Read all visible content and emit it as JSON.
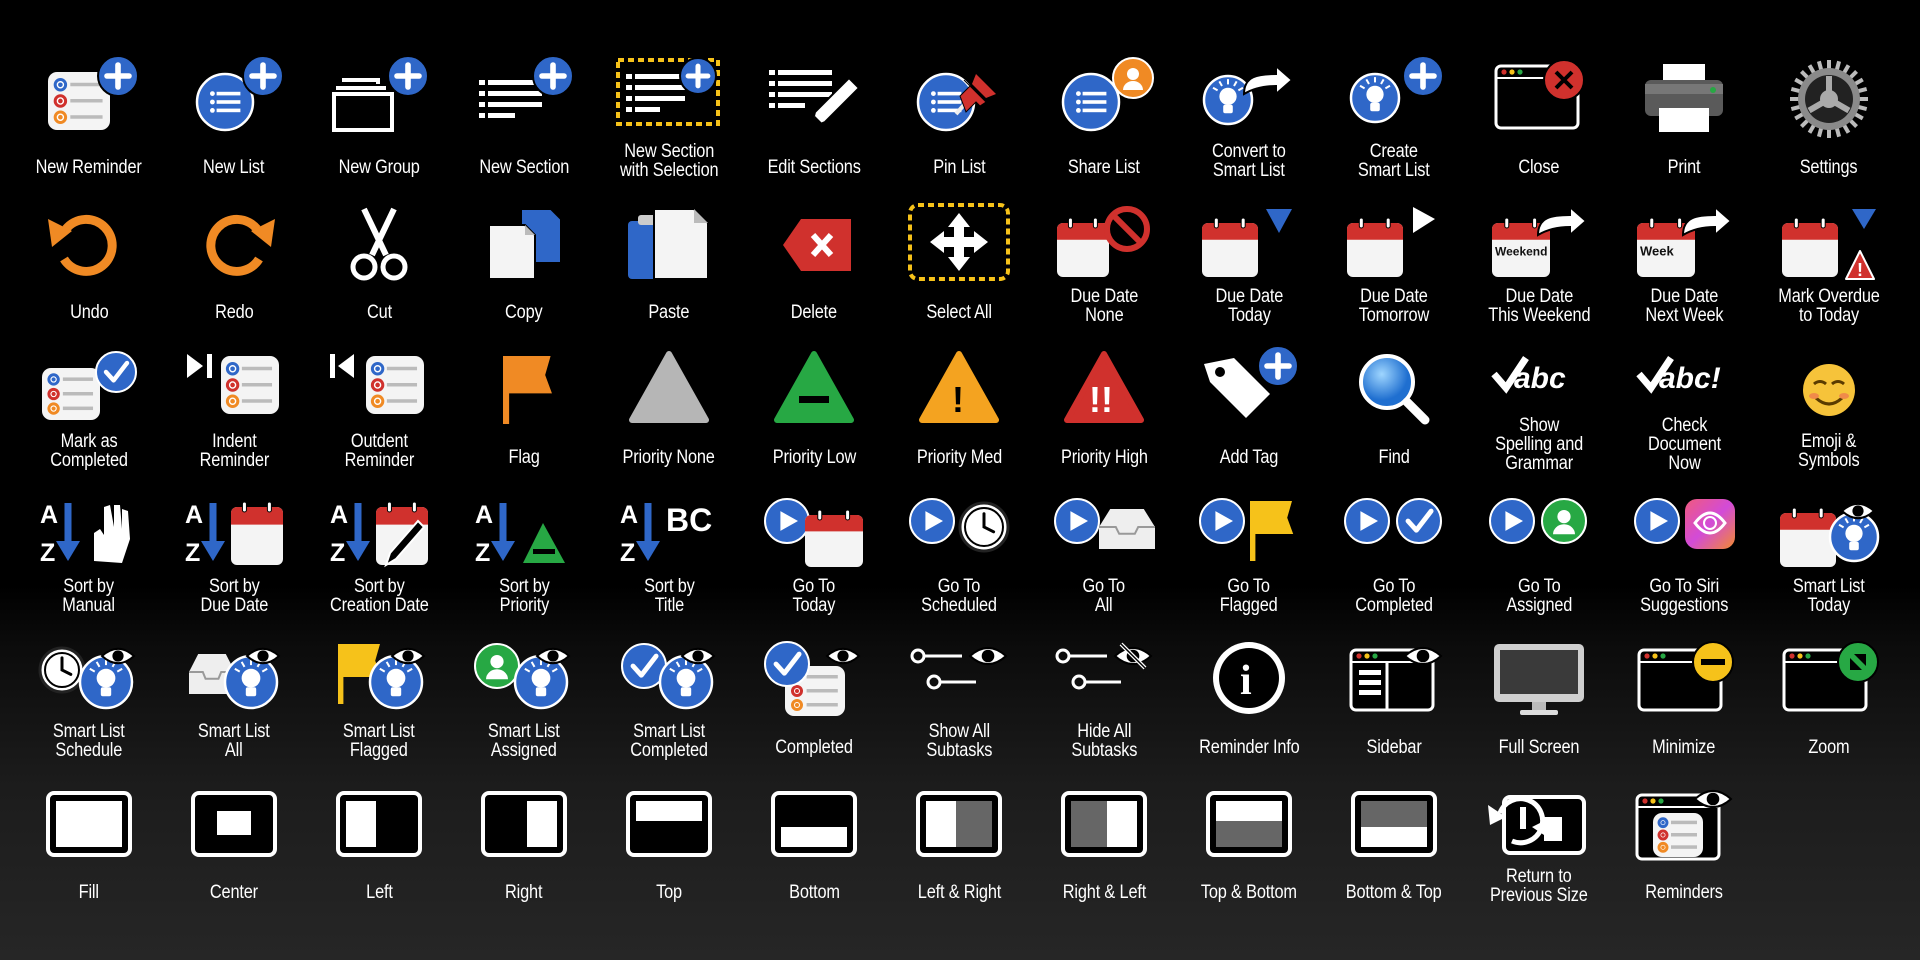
{
  "colors": {
    "blue": "#2f67c8",
    "orange": "#f08a24",
    "red": "#d0312d",
    "green": "#27a844",
    "yellow": "#f6c21a",
    "gray": "#9a9a9a"
  },
  "rows": [
    [
      {
        "id": "new-reminder",
        "icon": "reminders-list-plus-icon",
        "lines": [
          "New Reminder"
        ]
      },
      {
        "id": "new-list",
        "icon": "list-circle-plus-icon",
        "lines": [
          "New List"
        ]
      },
      {
        "id": "new-group",
        "icon": "folders-plus-icon",
        "lines": [
          "New Group"
        ]
      },
      {
        "id": "new-section",
        "icon": "lines-plus-icon",
        "lines": [
          "New Section"
        ]
      },
      {
        "id": "new-section-with-selection",
        "icon": "lines-plus-selection-icon",
        "lines": [
          "New Section",
          "with Selection"
        ]
      },
      {
        "id": "edit-sections",
        "icon": "lines-pencil-icon",
        "lines": [
          "Edit Sections"
        ]
      },
      {
        "id": "pin-list",
        "icon": "list-pin-icon",
        "lines": [
          "Pin List"
        ]
      },
      {
        "id": "share-list",
        "icon": "list-person-icon",
        "lines": [
          "Share List"
        ]
      },
      {
        "id": "convert-to-smart-list",
        "icon": "lightbulb-arrow-icon",
        "lines": [
          "Convert to",
          "Smart List"
        ]
      },
      {
        "id": "create-smart-list",
        "icon": "lightbulb-plus-icon",
        "lines": [
          "Create",
          "Smart List"
        ]
      },
      {
        "id": "close",
        "icon": "window-close-icon",
        "lines": [
          "Close"
        ]
      },
      {
        "id": "print",
        "icon": "printer-icon",
        "lines": [
          "Print"
        ]
      },
      {
        "id": "settings",
        "icon": "gear-icon",
        "lines": [
          "Settings"
        ]
      }
    ],
    [
      {
        "id": "undo",
        "icon": "undo-arrow-icon",
        "lines": [
          "Undo"
        ]
      },
      {
        "id": "redo",
        "icon": "redo-arrow-icon",
        "lines": [
          "Redo"
        ]
      },
      {
        "id": "cut",
        "icon": "scissors-icon",
        "lines": [
          "Cut"
        ]
      },
      {
        "id": "copy",
        "icon": "copy-docs-icon",
        "lines": [
          "Copy"
        ]
      },
      {
        "id": "paste",
        "icon": "clipboard-icon",
        "lines": [
          "Paste"
        ]
      },
      {
        "id": "delete",
        "icon": "delete-key-icon",
        "lines": [
          "Delete"
        ]
      },
      {
        "id": "select-all",
        "icon": "move-arrows-selection-icon",
        "lines": [
          "Select All"
        ]
      },
      {
        "id": "due-date-none",
        "icon": "calendar-none-icon",
        "lines": [
          "Due Date",
          "None"
        ]
      },
      {
        "id": "due-date-today",
        "icon": "calendar-down-triangle-icon",
        "lines": [
          "Due Date",
          "Today"
        ]
      },
      {
        "id": "due-date-tomorrow",
        "icon": "calendar-right-triangle-icon",
        "lines": [
          "Due Date",
          "Tomorrow"
        ]
      },
      {
        "id": "due-date-this-weekend",
        "icon": "calendar-weekend-arrow-icon",
        "lines": [
          "Due Date",
          "This Weekend"
        ],
        "badge": "Weekend"
      },
      {
        "id": "due-date-next-week",
        "icon": "calendar-week-arrow-icon",
        "lines": [
          "Due Date",
          "Next Week"
        ],
        "badge": "Week"
      },
      {
        "id": "mark-overdue-to-today",
        "icon": "calendar-warning-icon",
        "lines": [
          "Mark Overdue",
          "to Today"
        ]
      }
    ],
    [
      {
        "id": "mark-as-completed",
        "icon": "reminders-checkmark-icon",
        "lines": [
          "Mark as",
          "Completed"
        ]
      },
      {
        "id": "indent-reminder",
        "icon": "indent-icon",
        "lines": [
          "Indent",
          "Reminder"
        ]
      },
      {
        "id": "outdent-reminder",
        "icon": "outdent-icon",
        "lines": [
          "Outdent",
          "Reminder"
        ]
      },
      {
        "id": "flag",
        "icon": "flag-icon",
        "lines": [
          "Flag"
        ]
      },
      {
        "id": "priority-none",
        "icon": "triangle-gray-icon",
        "lines": [
          "Priority None"
        ]
      },
      {
        "id": "priority-low",
        "icon": "triangle-green-minus-icon",
        "lines": [
          "Priority Low"
        ]
      },
      {
        "id": "priority-med",
        "icon": "triangle-orange-exclaim-icon",
        "lines": [
          "Priority Med"
        ]
      },
      {
        "id": "priority-high",
        "icon": "triangle-red-double-exclaim-icon",
        "lines": [
          "Priority High"
        ]
      },
      {
        "id": "add-tag",
        "icon": "tag-plus-icon",
        "lines": [
          "Add Tag"
        ]
      },
      {
        "id": "find",
        "icon": "magnifier-icon",
        "lines": [
          "Find"
        ]
      },
      {
        "id": "show-spelling-and-grammar",
        "icon": "check-abc-icon",
        "lines": [
          "Show",
          "Spelling and",
          "Grammar"
        ],
        "badge": "abc"
      },
      {
        "id": "check-document-now",
        "icon": "check-abc-exclaim-icon",
        "lines": [
          "Check",
          "Document",
          "Now"
        ],
        "badge": "abc!"
      },
      {
        "id": "emoji-and-symbols",
        "icon": "smiley-icon",
        "lines": [
          "Emoji &",
          "Symbols"
        ]
      }
    ],
    [
      {
        "id": "sort-by-manual",
        "icon": "sort-hand-icon",
        "lines": [
          "Sort by",
          "Manual"
        ]
      },
      {
        "id": "sort-by-due-date",
        "icon": "sort-calendar-icon",
        "lines": [
          "Sort by",
          "Due Date"
        ]
      },
      {
        "id": "sort-by-creation-date",
        "icon": "sort-calendar-pen-icon",
        "lines": [
          "Sort by",
          "Creation Date"
        ]
      },
      {
        "id": "sort-by-priority",
        "icon": "sort-triangle-icon",
        "lines": [
          "Sort by",
          "Priority"
        ]
      },
      {
        "id": "sort-by-title",
        "icon": "sort-bc-icon",
        "lines": [
          "Sort by",
          "Title"
        ],
        "badge": "BC"
      },
      {
        "id": "go-to-today",
        "icon": "play-calendar-icon",
        "lines": [
          "Go To",
          "Today"
        ]
      },
      {
        "id": "go-to-scheduled",
        "icon": "play-clock-icon",
        "lines": [
          "Go To",
          "Scheduled"
        ]
      },
      {
        "id": "go-to-all",
        "icon": "play-tray-icon",
        "lines": [
          "Go To",
          "All"
        ]
      },
      {
        "id": "go-to-flagged",
        "icon": "play-flag-icon",
        "lines": [
          "Go To",
          "Flagged"
        ]
      },
      {
        "id": "go-to-completed",
        "icon": "play-check-icon",
        "lines": [
          "Go To",
          "Completed"
        ]
      },
      {
        "id": "go-to-assigned",
        "icon": "play-person-icon",
        "lines": [
          "Go To",
          "Assigned"
        ]
      },
      {
        "id": "go-to-siri-suggestions",
        "icon": "play-siri-icon",
        "lines": [
          "Go To Siri",
          "Suggestions"
        ]
      },
      {
        "id": "smart-list-today",
        "icon": "calendar-lightbulb-eye-icon",
        "lines": [
          "Smart List",
          "Today"
        ]
      }
    ],
    [
      {
        "id": "smart-list-schedule",
        "icon": "clock-lightbulb-eye-icon",
        "lines": [
          "Smart List",
          "Schedule"
        ]
      },
      {
        "id": "smart-list-all",
        "icon": "tray-lightbulb-eye-icon",
        "lines": [
          "Smart List",
          "All"
        ]
      },
      {
        "id": "smart-list-flagged",
        "icon": "flag-lightbulb-eye-icon",
        "lines": [
          "Smart List",
          "Flagged"
        ]
      },
      {
        "id": "smart-list-assigned",
        "icon": "person-lightbulb-eye-icon",
        "lines": [
          "Smart List",
          "Assigned"
        ]
      },
      {
        "id": "smart-list-completed",
        "icon": "check-lightbulb-eye-icon",
        "lines": [
          "Smart List",
          "Completed"
        ]
      },
      {
        "id": "completed",
        "icon": "check-reminders-eye-icon",
        "lines": [
          "Completed"
        ]
      },
      {
        "id": "show-all-subtasks",
        "icon": "subtasks-eye-icon",
        "lines": [
          "Show All",
          "Subtasks"
        ]
      },
      {
        "id": "hide-all-subtasks",
        "icon": "subtasks-eye-slash-icon",
        "lines": [
          "Hide All",
          "Subtasks"
        ]
      },
      {
        "id": "reminder-info",
        "icon": "info-circle-icon",
        "lines": [
          "Reminder Info"
        ],
        "badge": "i"
      },
      {
        "id": "sidebar",
        "icon": "window-sidebar-eye-icon",
        "lines": [
          "Sidebar"
        ]
      },
      {
        "id": "full-screen",
        "icon": "monitor-icon",
        "lines": [
          "Full Screen"
        ]
      },
      {
        "id": "minimize",
        "icon": "window-minimize-icon",
        "lines": [
          "Minimize"
        ]
      },
      {
        "id": "zoom",
        "icon": "window-zoom-icon",
        "lines": [
          "Zoom"
        ]
      }
    ],
    [
      {
        "id": "fill",
        "icon": "tile-fill-icon",
        "lines": [
          "Fill"
        ]
      },
      {
        "id": "center",
        "icon": "tile-center-icon",
        "lines": [
          "Center"
        ]
      },
      {
        "id": "left",
        "icon": "tile-left-icon",
        "lines": [
          "Left"
        ]
      },
      {
        "id": "right",
        "icon": "tile-right-icon",
        "lines": [
          "Right"
        ]
      },
      {
        "id": "top",
        "icon": "tile-top-icon",
        "lines": [
          "Top"
        ]
      },
      {
        "id": "bottom",
        "icon": "tile-bottom-icon",
        "lines": [
          "Bottom"
        ]
      },
      {
        "id": "left-and-right",
        "icon": "tile-left-right-icon",
        "lines": [
          "Left & Right"
        ]
      },
      {
        "id": "right-and-left",
        "icon": "tile-right-left-icon",
        "lines": [
          "Right & Left"
        ]
      },
      {
        "id": "top-and-bottom",
        "icon": "tile-top-bottom-icon",
        "lines": [
          "Top & Bottom"
        ]
      },
      {
        "id": "bottom-and-top",
        "icon": "tile-bottom-top-icon",
        "lines": [
          "Bottom & Top"
        ]
      },
      {
        "id": "return-to-previous-size",
        "icon": "restore-size-icon",
        "lines": [
          "Return to",
          "Previous Size"
        ]
      },
      {
        "id": "reminders",
        "icon": "window-reminders-eye-icon",
        "lines": [
          "Reminders"
        ]
      }
    ]
  ]
}
